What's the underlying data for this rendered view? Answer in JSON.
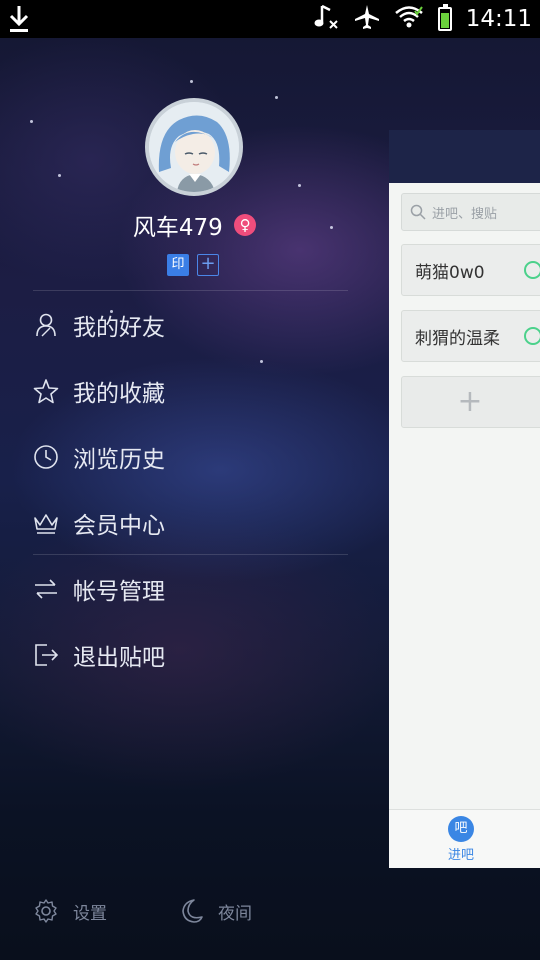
{
  "status_bar": {
    "time": "14:11",
    "icons": [
      "download-icon",
      "music-muted-icon",
      "airplane-icon",
      "wifi-icon",
      "battery-icon"
    ],
    "battery_color": "#6bd13c"
  },
  "drawer": {
    "username": "风车479",
    "gender_symbol": "♀",
    "badge_yin": "印",
    "badge_plus": "+",
    "menu": [
      {
        "label": "我的好友",
        "icon": "friends-icon"
      },
      {
        "label": "我的收藏",
        "icon": "star-icon"
      },
      {
        "label": "浏览历史",
        "icon": "clock-icon"
      },
      {
        "label": "会员中心",
        "icon": "crown-icon"
      },
      {
        "label": "帐号管理",
        "icon": "swap-icon"
      },
      {
        "label": "退出贴吧",
        "icon": "logout-icon"
      }
    ],
    "bottom": {
      "settings_label": "设置",
      "night_label": "夜间"
    }
  },
  "panel": {
    "search_placeholder": "进吧、搜贴",
    "cards": [
      "萌猫0w0",
      "刺猬的温柔"
    ],
    "add_symbol": "+",
    "footer_tab_icon_text": "吧",
    "footer_tab_label": "进吧"
  },
  "colors": {
    "accent_blue": "#3a86e4",
    "gender_pink": "#ef4d7c",
    "check_green": "#4bd18b"
  }
}
